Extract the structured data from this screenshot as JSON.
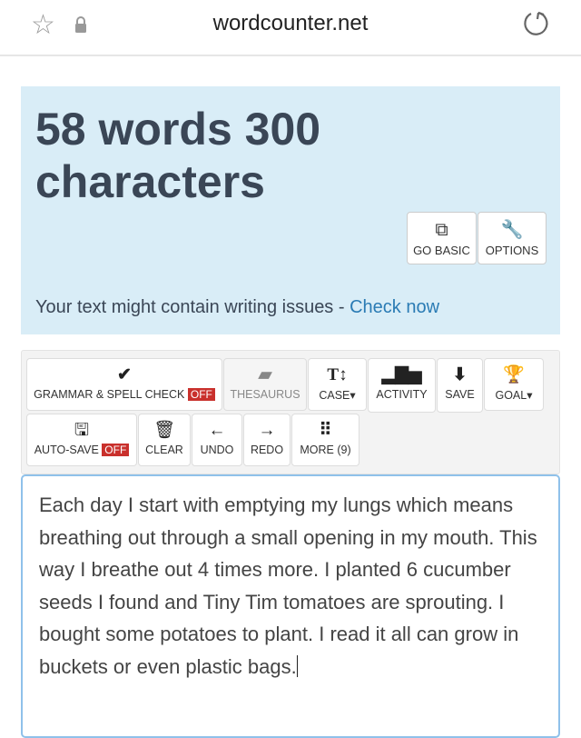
{
  "browser": {
    "url": "wordcounter.net",
    "icons": [
      "star-icon",
      "lock-icon",
      "reload-icon"
    ]
  },
  "stats": {
    "line1": "58 words 300",
    "line2": "characters"
  },
  "hero_buttons": [
    {
      "label": "GO BASIC",
      "icon": "external-link-icon"
    },
    {
      "label": "OPTIONS",
      "icon": "wrench-icon"
    }
  ],
  "issues": {
    "text": "Your text might contain writing issues - ",
    "link": "Check now"
  },
  "toolbar": {
    "grammar": "GRAMMAR & SPELL CHECK",
    "grammar_state": "OFF",
    "thesaurus": "THESAURUS",
    "case": "CASE",
    "activity": "ACTIVITY",
    "save": "SAVE",
    "goal": "GOAL",
    "autosave": "AUTO-SAVE",
    "autosave_state": "OFF",
    "clear": "CLEAR",
    "undo": "UNDO",
    "redo": "REDO",
    "more": "MORE (9)"
  },
  "editor": {
    "text": "Each day I start with emptying my lungs which means breathing out through a small opening in my mouth. This way I breathe out 4 times more. I planted 6 cucumber seeds I found and Tiny Tim tomatoes are sprouting. I bought some potatoes to plant. I read it all can grow in buckets or even plastic bags."
  },
  "colors": {
    "hero_bg": "#d9edf7",
    "off_badge": "#c9302c",
    "link": "#2a7bb4"
  }
}
